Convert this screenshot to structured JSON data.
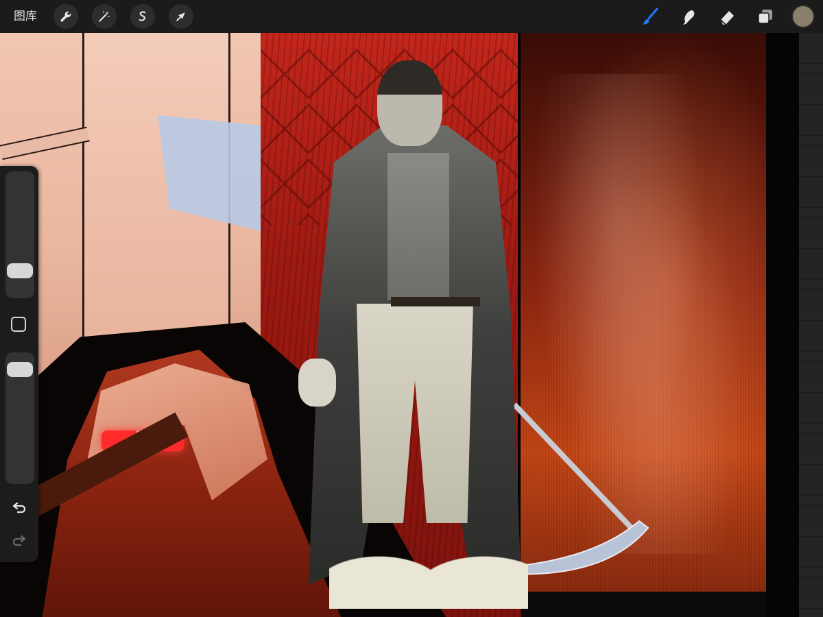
{
  "app": {
    "gallery_label": "图库"
  },
  "toolbar": {
    "left_tools": [
      {
        "name": "actions",
        "icon": "wrench-icon"
      },
      {
        "name": "adjustments",
        "icon": "magic-wand-icon"
      },
      {
        "name": "selection",
        "icon": "selection-s-icon"
      },
      {
        "name": "transform",
        "icon": "arrow-cursor-icon"
      }
    ],
    "right_tools": [
      {
        "name": "brush",
        "icon": "brush-icon",
        "active": true
      },
      {
        "name": "smudge",
        "icon": "smudge-icon",
        "active": false
      },
      {
        "name": "eraser",
        "icon": "eraser-icon",
        "active": false
      },
      {
        "name": "layers",
        "icon": "layers-icon",
        "active": false
      }
    ],
    "current_color": "#8a7f6b"
  },
  "sidebar": {
    "brush_size_level": 0.17,
    "brush_opacity_level": 0.93,
    "undo_icon": "undo-icon",
    "redo_icon": "redo-icon",
    "modify_icon": "square-icon"
  },
  "colors": {
    "accent_active": "#1f7cff",
    "toolbar_bg": "#1b1b1b",
    "icon_default": "#e6e6e6",
    "icon_dim": "#6a6a6a"
  }
}
